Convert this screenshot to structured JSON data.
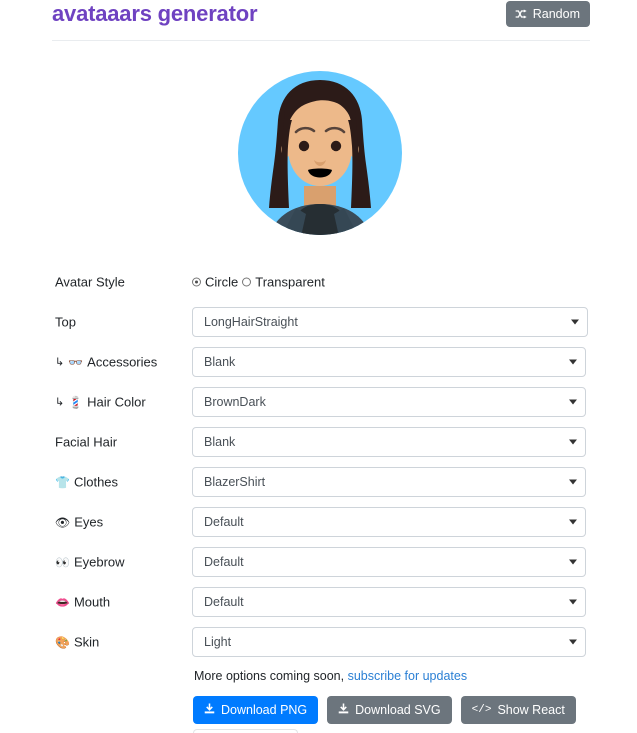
{
  "header": {
    "title": "avataaars generator",
    "random_button": {
      "label": "Random",
      "icon": "shuffle-icon"
    },
    "title_color": "#6f42c1",
    "random_button_color": "#6c757d"
  },
  "avatar": {
    "alt": "avatar-preview",
    "background_color": "#65C9FF",
    "hair_color": "#2C1B18",
    "skin_color": "#EDB98A",
    "clothes_color": "#3A4C5A",
    "shirt_color": "#262E33",
    "eye_color": "#2C1B18",
    "mouth_color": "#000000"
  },
  "form": {
    "rows": [
      {
        "label": "Avatar Style",
        "icon": "",
        "nested": false,
        "control": "radio",
        "options": [
          {
            "label": "Circle",
            "selected": true
          },
          {
            "label": "Transparent",
            "selected": false
          }
        ]
      },
      {
        "label": "Top",
        "icon": "",
        "nested": false,
        "control": "select",
        "value": "LongHairStraight",
        "wide": true
      },
      {
        "label": "Accessories",
        "icon": "👓",
        "nested": true,
        "control": "select",
        "value": "Blank",
        "wide": false
      },
      {
        "label": "Hair Color",
        "icon": "💈",
        "nested": true,
        "control": "select",
        "value": "BrownDark",
        "wide": false
      },
      {
        "label": "Facial Hair",
        "icon": "",
        "nested": false,
        "control": "select",
        "value": "Blank",
        "wide": false
      },
      {
        "label": "Clothes",
        "icon": "👕",
        "nested": false,
        "control": "select",
        "value": "BlazerShirt",
        "wide": false
      },
      {
        "label": "Eyes",
        "icon": "👁",
        "nested": false,
        "control": "select",
        "value": "Default",
        "wide": false
      },
      {
        "label": "Eyebrow",
        "icon": "👀",
        "nested": false,
        "control": "select",
        "value": "Default",
        "wide": false
      },
      {
        "label": "Mouth",
        "icon": "👄",
        "nested": false,
        "control": "select",
        "value": "Default",
        "wide": false
      },
      {
        "label": "Skin",
        "icon": "🎨",
        "nested": false,
        "control": "select",
        "value": "Light",
        "wide": false
      }
    ],
    "nest_marker": "↳"
  },
  "footer": {
    "note_text": "More options coming soon,",
    "note_link": "subscribe for updates",
    "buttons": [
      {
        "label": "Download PNG",
        "icon": "⬇",
        "style": "primary",
        "color": "#007bff"
      },
      {
        "label": "Download SVG",
        "icon": "⬇",
        "style": "secondary",
        "color": "#6c757d"
      },
      {
        "label": "Show React",
        "icon": "</>",
        "style": "secondary",
        "color": "#6c757d"
      }
    ]
  }
}
